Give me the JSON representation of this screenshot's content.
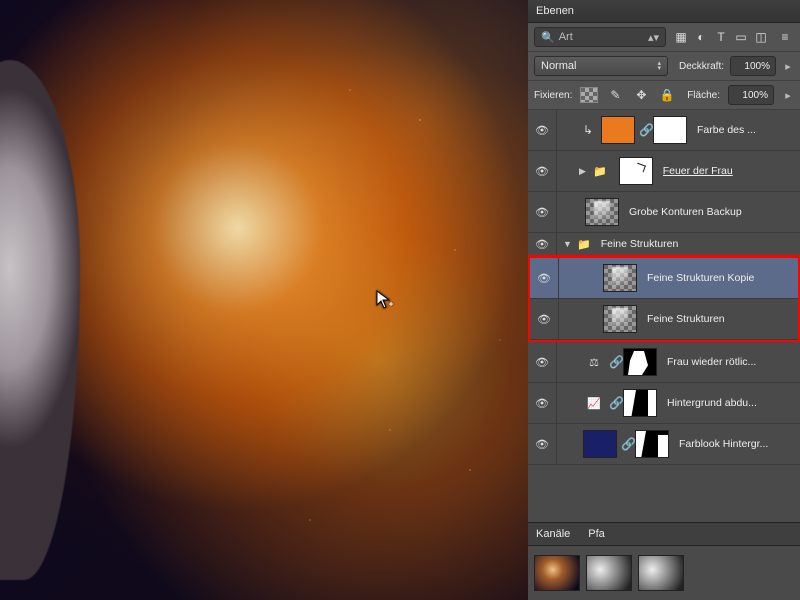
{
  "panel": {
    "title": "Ebenen"
  },
  "search": {
    "label": "Art"
  },
  "icons": {
    "image": "image-filter-icon",
    "adjust": "adjustment-icon",
    "type": "T",
    "shape": "shape-icon",
    "smart": "smart-object-icon",
    "menu": "≡"
  },
  "blend": {
    "mode": "Normal"
  },
  "opacity": {
    "label": "Deckkraft:",
    "value": "100%"
  },
  "lock": {
    "label": "Fixieren:"
  },
  "fill": {
    "label": "Fläche:",
    "value": "100%"
  },
  "layers": [
    {
      "id": "farbe",
      "name": "Farbe des ...",
      "type": "solid",
      "swatch": "orange",
      "mask": "white",
      "indent": 1,
      "clip": true
    },
    {
      "id": "feuer",
      "name": "Feuer der Frau ",
      "type": "group",
      "expanded": false,
      "mask": "white-scribble",
      "underline": true,
      "indent": 1
    },
    {
      "id": "grobe",
      "name": "Grobe Konturen Backup",
      "type": "raster",
      "swatch": "checker",
      "indent": 0
    },
    {
      "id": "grp-fs",
      "name": "Feine Strukturen",
      "type": "group-header",
      "expanded": true,
      "indent": 0
    },
    {
      "id": "fs-kopie",
      "name": "Feine Strukturen Kopie",
      "type": "raster",
      "swatch": "checker",
      "indent": 2,
      "selected": true
    },
    {
      "id": "fs",
      "name": "Feine Strukturen",
      "type": "raster",
      "swatch": "checker",
      "indent": 2
    },
    {
      "id": "frau",
      "name": "Frau wieder rötlic...",
      "type": "adjust",
      "adjust": "balance",
      "mask": "mask-frau",
      "indent": 1
    },
    {
      "id": "hg-abdu",
      "name": "Hintergrund abdu...",
      "type": "adjust",
      "adjust": "curves",
      "mask": "mask-hg",
      "indent": 1
    },
    {
      "id": "farblook",
      "name": "Farblook Hintergr...",
      "type": "solid",
      "swatch": "navy",
      "mask": "mask-fl",
      "indent": 1
    }
  ],
  "channels": {
    "tab1": "Kanäle",
    "tab2": "Pfa"
  }
}
